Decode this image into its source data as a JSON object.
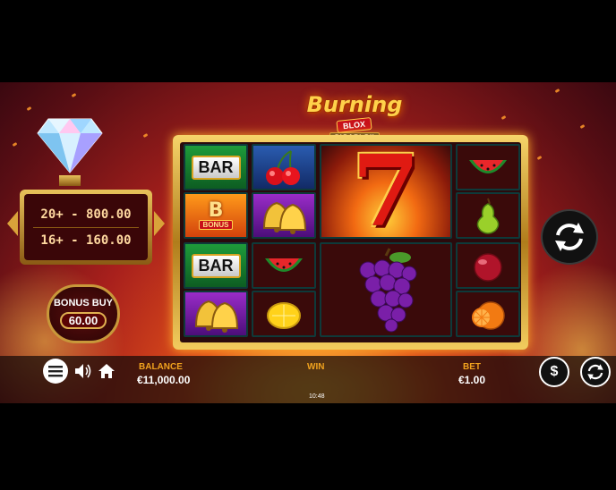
{
  "logo": {
    "title": "Burning",
    "sub": "BLOX",
    "badge": "GIGABLOX"
  },
  "jackpots": [
    {
      "label": "20+ - 800.00"
    },
    {
      "label": "16+ - 160.00"
    }
  ],
  "bonus_buy": {
    "label": "BONUS BUY",
    "price": "60.00"
  },
  "reels": {
    "bar_label": "BAR",
    "bonus_letter": "B",
    "bonus_text": "BONUS",
    "seven": "7"
  },
  "footer": {
    "balance_label": "BALANCE",
    "balance_value": "€11,000.00",
    "win_label": "WIN",
    "time": "10:48",
    "bet_label": "BET",
    "bet_value": "€1.00",
    "currency_symbol": "$"
  },
  "colors": {
    "accent": "#f0a21e",
    "frame_gold": "#d9a322"
  }
}
